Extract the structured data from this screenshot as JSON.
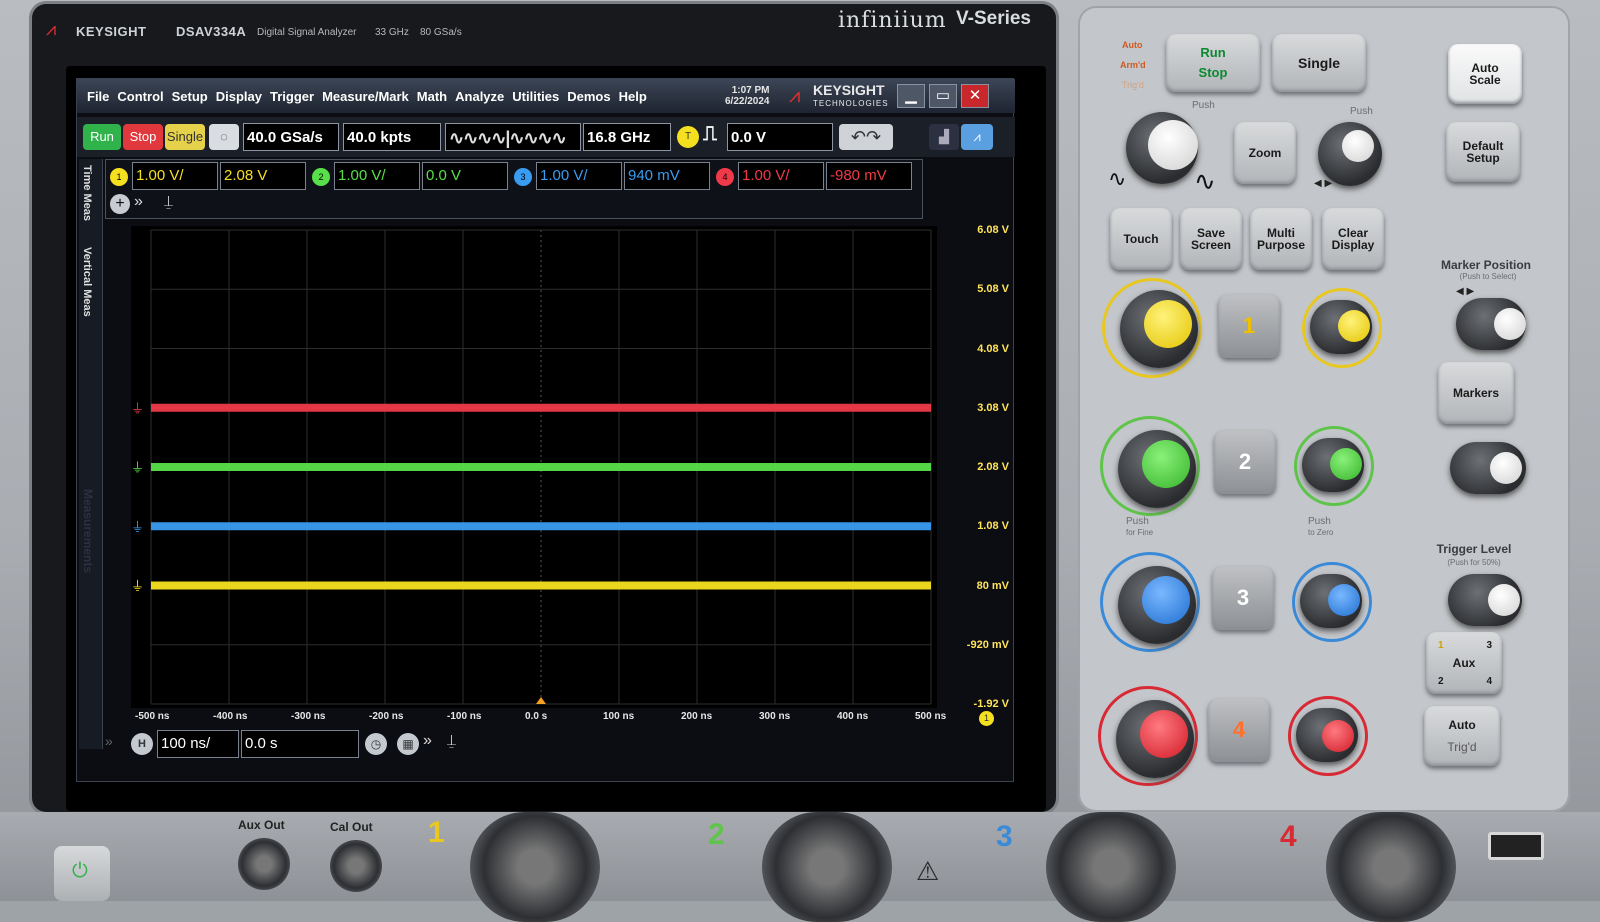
{
  "bezel": {
    "brand": "KEYSIGHT",
    "model": "DSAV334A",
    "model_desc": "Digital Signal Analyzer",
    "bandwidth": "33 GHz",
    "sample_rate_label": "80 GSa/s",
    "series_name": "infiniium",
    "series": "V-Series"
  },
  "menubar": {
    "items": [
      "File",
      "Control",
      "Setup",
      "Display",
      "Trigger",
      "Measure/Mark",
      "Math",
      "Analyze",
      "Utilities",
      "Demos",
      "Help"
    ],
    "time": "1:07 PM",
    "date": "6/22/2024",
    "logo_text": "KEYSIGHT",
    "logo_sub": "TECHNOLOGIES"
  },
  "toolbar": {
    "run": "Run",
    "stop": "Stop",
    "single": "Single",
    "sample_rate": "40.0 GSa/s",
    "memory_depth": "40.0 kpts",
    "bandwidth": "16.8 GHz",
    "trigger_badge": "T",
    "trigger_level": "0.0 V"
  },
  "channels": [
    {
      "num": "1",
      "scale": "1.00 V/",
      "offset": "2.08 V",
      "color": "#f5e020"
    },
    {
      "num": "2",
      "scale": "1.00 V/",
      "offset": "0.0 V",
      "color": "#58e04a"
    },
    {
      "num": "3",
      "scale": "1.00 V/",
      "offset": "940 mV",
      "color": "#3a9cf0"
    },
    {
      "num": "4",
      "scale": "1.00 V/",
      "offset": "-980 mV",
      "color": "#f03a4a"
    }
  ],
  "sidetabs": {
    "time_meas": "Time Meas",
    "vertical_meas": "Vertical Meas",
    "measurements": "Measurements"
  },
  "y_axis": [
    "6.08 V",
    "5.08 V",
    "4.08 V",
    "3.08 V",
    "2.08 V",
    "1.08 V",
    "80 mV",
    "-920 mV",
    "-1.92 V"
  ],
  "x_axis": [
    "-500 ns",
    "-400 ns",
    "-300 ns",
    "-200 ns",
    "-100 ns",
    "0.0 s",
    "100 ns",
    "200 ns",
    "300 ns",
    "400 ns",
    "500 ns"
  ],
  "x_marker_badge": "1",
  "timebase": {
    "badge": "H",
    "scale": "100 ns/",
    "delay": "0.0 s"
  },
  "front_panel": {
    "auto": "Auto",
    "armd": "Arm'd",
    "trigd": "Trig'd",
    "run_stop": [
      "Run",
      "Stop"
    ],
    "single": "Single",
    "auto_scale": [
      "Auto",
      "Scale"
    ],
    "default_setup": [
      "Default",
      "Setup"
    ],
    "push": "Push",
    "push_for_fine": "Push",
    "for_fine": "for Fine",
    "push_to_zero": "Push",
    "to_zero": "to Zero",
    "zoom": "Zoom",
    "touch": "Touch",
    "save_screen": [
      "Save",
      "Screen"
    ],
    "multi_purpose": [
      "Multi",
      "Purpose"
    ],
    "clear_display": [
      "Clear",
      "Display"
    ],
    "marker_position": "Marker Position",
    "push_to_select": "(Push to Select)",
    "markers": "Markers",
    "trigger_level": "Trigger Level",
    "push_for_50": "(Push for 50%)",
    "aux": "Aux",
    "aux_nums": [
      "1",
      "3",
      "2",
      "4"
    ],
    "auto_trigd": [
      "Auto",
      "Trig'd"
    ],
    "ch_keys": [
      "1",
      "2",
      "3",
      "4"
    ]
  },
  "bottom": {
    "aux_out": "Aux Out",
    "cal_out": "Cal Out",
    "inputs": [
      "1",
      "2",
      "3",
      "4"
    ]
  }
}
